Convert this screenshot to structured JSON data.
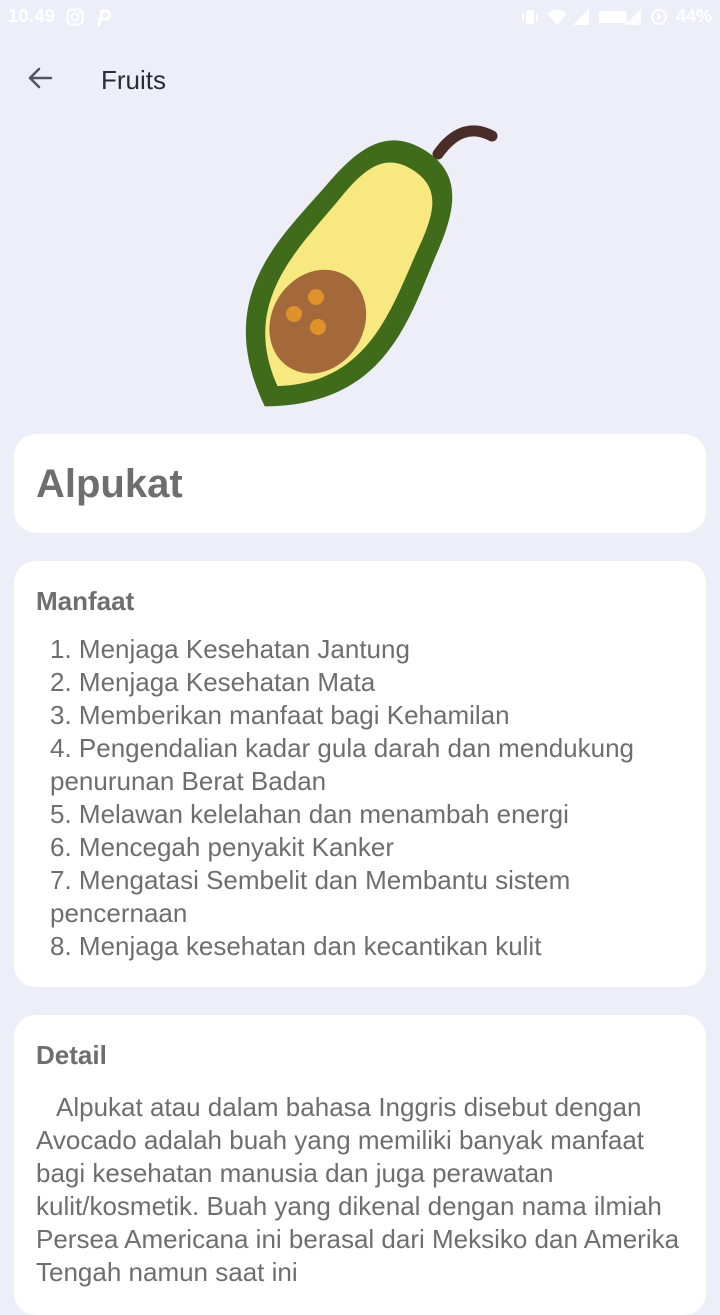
{
  "status_bar": {
    "time": "10.49",
    "battery": "44%",
    "left_icons": [
      "instagram-icon",
      "pinterest-icon"
    ],
    "right_icons": [
      "vibrate-icon",
      "wifi-icon",
      "signal-icon",
      "volte-icon",
      "signal-icon",
      "sync-icon"
    ]
  },
  "app_bar": {
    "title": "Fruits",
    "back_icon": "back-arrow-icon"
  },
  "hero": {
    "illustration": "avocado-illustration",
    "colors": {
      "skin": "#3f6b1a",
      "flesh": "#f8e880",
      "seed": "#a3693a",
      "dots": "#e0922a",
      "stem": "#4a2d28"
    }
  },
  "fruit": {
    "name": "Alpukat"
  },
  "benefits": {
    "title": "Manfaat",
    "items": [
      "1. Menjaga Kesehatan Jantung",
      "2. Menjaga Kesehatan Mata",
      "3. Memberikan manfaat bagi Kehamilan",
      "4. Pengendalian kadar gula darah dan mendukung penurunan Berat Badan",
      "5. Melawan kelelahan dan menambah energi",
      "6. Mencegah penyakit Kanker",
      "7. Mengatasi Sembelit dan Membantu sistem pencernaan",
      "8. Menjaga kesehatan dan kecantikan kulit"
    ]
  },
  "detail": {
    "title": "Detail",
    "text": "Alpukat atau dalam bahasa Inggris disebut dengan Avocado adalah buah yang memiliki banyak manfaat bagi kesehatan manusia dan juga perawatan kulit/kosmetik. Buah yang dikenal dengan nama ilmiah Persea Americana ini berasal dari Meksiko dan Amerika Tengah namun saat ini"
  },
  "colors": {
    "background": "#eeeef8",
    "card": "#ffffff",
    "text": "#6e6e6e",
    "title": "#2b2b35"
  }
}
